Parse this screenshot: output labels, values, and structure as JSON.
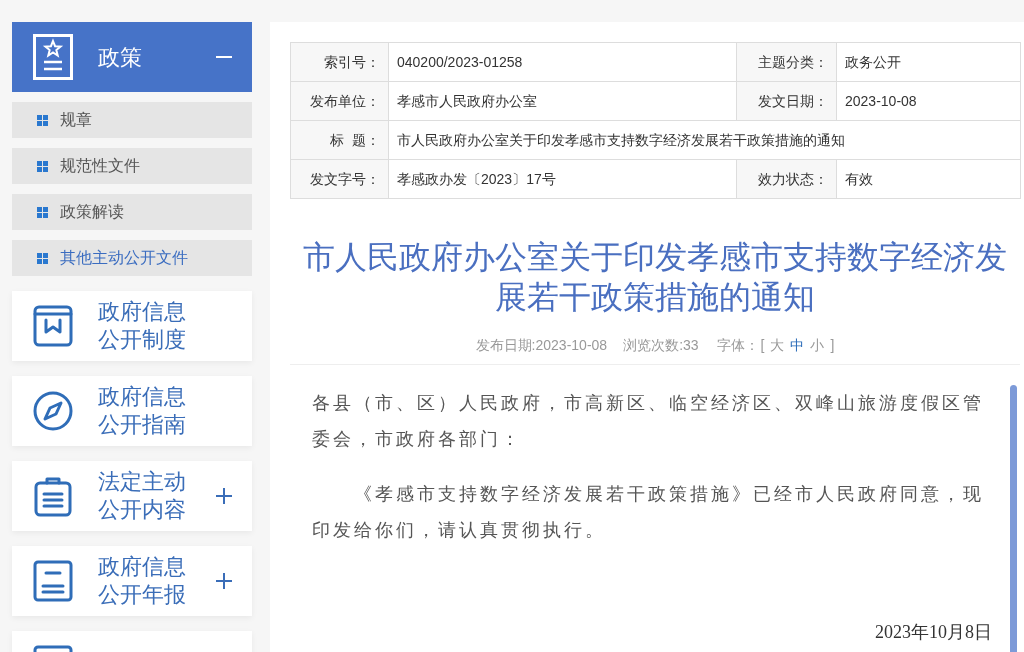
{
  "sidebar": {
    "section": {
      "title": "政策",
      "expanded": true,
      "items": [
        {
          "label": "规章",
          "selected": false
        },
        {
          "label": "规范性文件",
          "selected": false
        },
        {
          "label": "政策解读",
          "selected": false
        },
        {
          "label": "其他主动公开文件",
          "selected": true
        }
      ]
    },
    "cards": [
      {
        "kind": "link",
        "lines": [
          "政府信息",
          "公开制度"
        ]
      },
      {
        "kind": "link",
        "lines": [
          "政府信息",
          "公开指南"
        ]
      },
      {
        "kind": "group",
        "lines": [
          "法定主动",
          "公开内容"
        ]
      },
      {
        "kind": "group",
        "lines": [
          "政府信息",
          "公开年报"
        ]
      },
      {
        "kind": "link"
      }
    ]
  },
  "info_table": {
    "rows": [
      [
        {
          "label": "索引号：",
          "value": "040200/2023-01258"
        },
        {
          "label": "主题分类：",
          "value": "政务公开"
        }
      ],
      [
        {
          "label": "发布单位：",
          "value": "孝感市人民政府办公室"
        },
        {
          "label": "发文日期：",
          "value": "2023-10-08"
        }
      ],
      [
        {
          "label": "标  题：",
          "value": "市人民政府办公室关于印发孝感市支持数字经济发展若干政策措施的通知"
        }
      ],
      [
        {
          "label": "发文字号：",
          "value": "孝感政办发〔2023〕17号"
        },
        {
          "label": "效力状态：",
          "value": "有效"
        }
      ]
    ]
  },
  "article": {
    "title": "市人民政府办公室关于印发孝感市支持数字经济发展若干政策措施的通知",
    "meta": {
      "date": "发布日期:2023-10-08",
      "views": "浏览次数:33",
      "font_label": "字体：",
      "bracket_open": "[",
      "font_sizes": [
        {
          "label": "大",
          "selected": false
        },
        {
          "label": "中",
          "selected": true
        },
        {
          "label": "小",
          "selected": false
        }
      ],
      "bracket_close": "]"
    },
    "paragraphs": [
      {
        "kind": "salutation",
        "text": "各县（市、区）人民政府，市高新区、临空经济区、双峰山旅游度假区管委会，市政府各部门："
      },
      {
        "kind": "body",
        "text": "《孝感市支持数字经济发展若干政策措施》已经市人民政府同意，现印发给你们，请认真贯彻执行。"
      }
    ],
    "date": "2023年10月8日"
  }
}
